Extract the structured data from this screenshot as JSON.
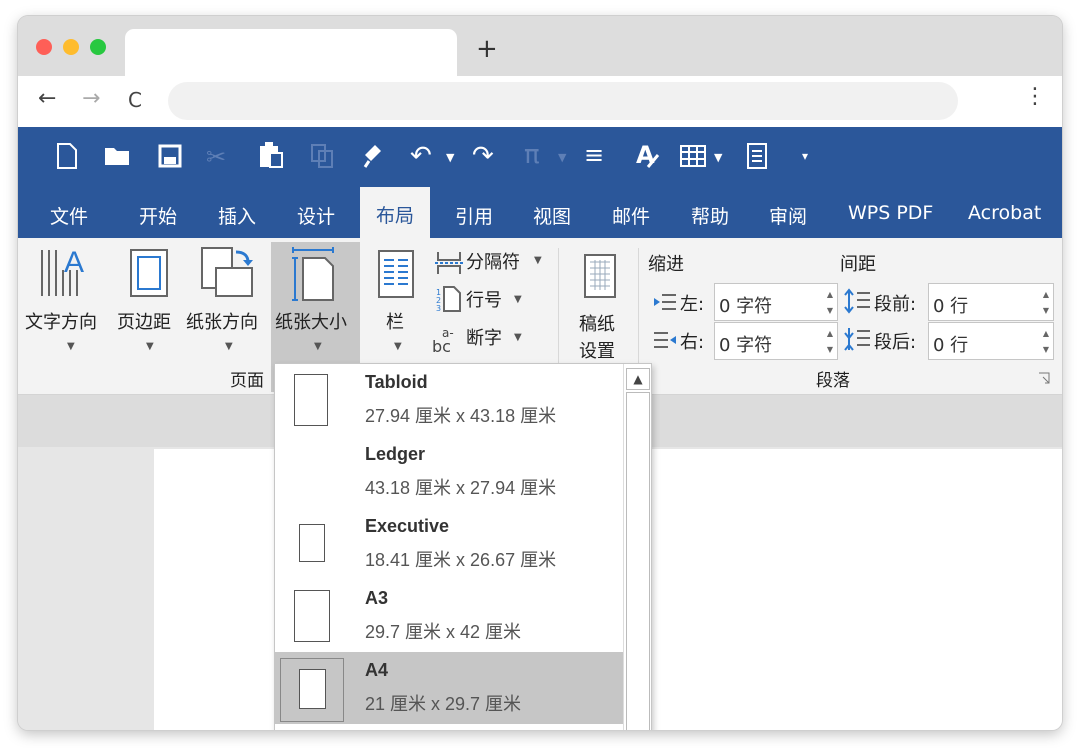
{
  "browser": {
    "new_tab": "+",
    "back": "←",
    "forward": "→",
    "reload": "C",
    "menu": "⋮"
  },
  "ribbon_tabs": [
    "文件",
    "开始",
    "插入",
    "设计",
    "布局",
    "引用",
    "视图",
    "邮件",
    "帮助",
    "审阅",
    "WPS PDF",
    "Acrobat"
  ],
  "active_tab": "布局",
  "page_setup": {
    "text_direction": "文字方向",
    "margins": "页边距",
    "orientation": "纸张方向",
    "size": "纸张大小",
    "columns": "栏",
    "breaks": "分隔符",
    "line_numbers": "行号",
    "hyphenation": "断字",
    "group_label": "页面"
  },
  "draft_paper": {
    "line1": "稿纸",
    "line2": "设置"
  },
  "paragraph": {
    "indent_title": "缩进",
    "spacing_title": "间距",
    "left_label": "左:",
    "right_label": "右:",
    "before_label": "段前:",
    "after_label": "段后:",
    "left_value": "0 字符",
    "right_value": "0 字符",
    "before_value": "0 行",
    "after_value": "0 行",
    "group_label": "段落"
  },
  "paper_sizes": [
    {
      "name": "Tabloid",
      "size": "27.94 厘米 x 43.18 厘米"
    },
    {
      "name": "Ledger",
      "size": "43.18 厘米 x 27.94 厘米"
    },
    {
      "name": "Executive",
      "size": "18.41 厘米 x 26.67 厘米"
    },
    {
      "name": "A3",
      "size": "29.7 厘米 x 42 厘米"
    },
    {
      "name": "A4",
      "size": "21 厘米 x 29.7 厘米"
    }
  ],
  "selected_paper": "A4",
  "colors": {
    "ribbon_blue": "#2b579a",
    "selection_gray": "#c6c6c6"
  }
}
